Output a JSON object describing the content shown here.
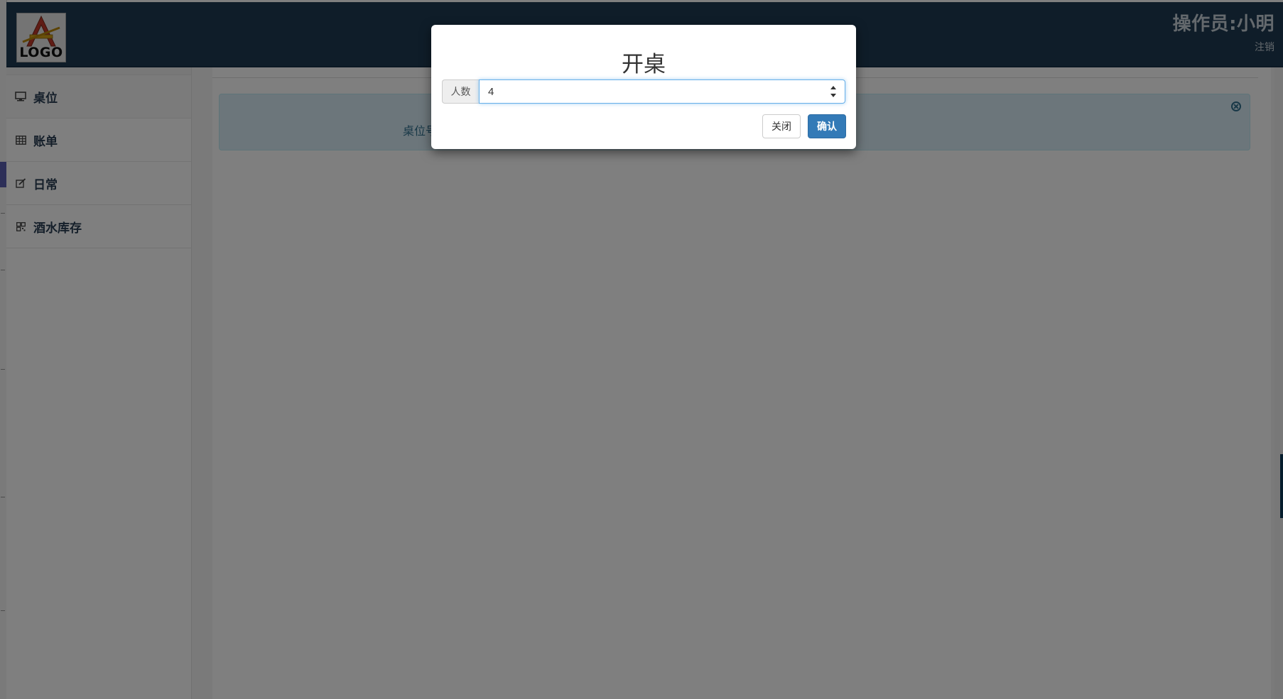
{
  "header": {
    "logo_text": "LOGO",
    "operator": "操作员:小明",
    "logout": "注销"
  },
  "sidebar": {
    "items": [
      {
        "label": "桌位",
        "icon": "monitor-icon"
      },
      {
        "label": "账单",
        "icon": "table-icon"
      },
      {
        "label": "日常",
        "icon": "edit-icon"
      },
      {
        "label": "酒水库存",
        "icon": "qrcode-icon"
      }
    ]
  },
  "main": {
    "info_label": "桌位号"
  },
  "modal": {
    "title": "开桌",
    "people_label": "人数",
    "people_value": "4",
    "close_label": "关闭",
    "confirm_label": "确认"
  },
  "colors": {
    "header_bg": "#1e3b52",
    "primary": "#337ab7",
    "info_bg": "#d9edf7"
  }
}
